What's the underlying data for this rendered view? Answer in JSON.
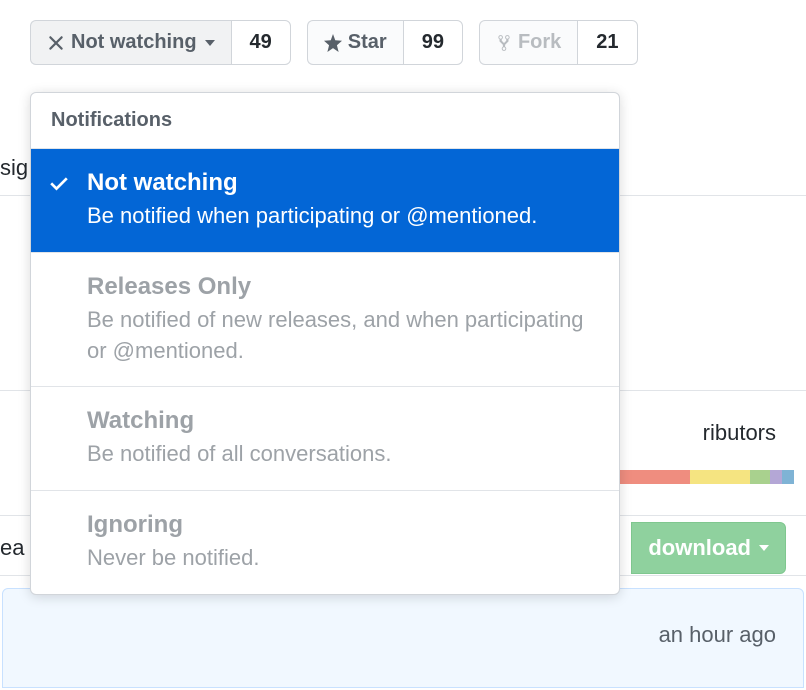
{
  "toolbar": {
    "watch": {
      "label": "Not watching",
      "count": "49"
    },
    "star": {
      "label": "Star",
      "count": "99"
    },
    "fork": {
      "label": "Fork",
      "count": "21"
    }
  },
  "dropdown": {
    "header": "Notifications",
    "items": [
      {
        "title": "Not watching",
        "desc": "Be notified when participating or @mentioned.",
        "selected": true
      },
      {
        "title": "Releases Only",
        "desc": "Be notified of new releases, and when participating or @mentioned.",
        "selected": false
      },
      {
        "title": "Watching",
        "desc": "Be notified of all conversations.",
        "selected": false
      },
      {
        "title": "Ignoring",
        "desc": "Never be notified.",
        "selected": false
      }
    ]
  },
  "background": {
    "partial_left_1": "sig",
    "partial_left_2": "ea",
    "contributors": "ributors",
    "download": "download",
    "time_ago": "an hour ago"
  },
  "lang_colors": [
    "#ef8d7f",
    "#f5e481",
    "#a9d18e",
    "#b4a7d6",
    "#7fb3d5"
  ]
}
